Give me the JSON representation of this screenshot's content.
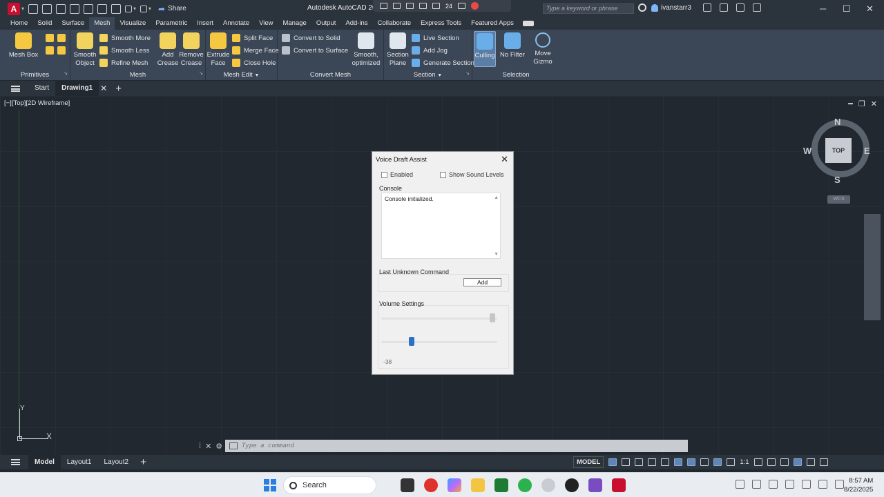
{
  "window": {
    "title": "Autodesk AutoCAD 20",
    "share_label": "Share",
    "search_placeholder": "Type a keyword or phrase",
    "user": "ivanstarr3",
    "recorder_time": "24"
  },
  "ribbon_tabs": [
    "Home",
    "Solid",
    "Surface",
    "Mesh",
    "Visualize",
    "Parametric",
    "Insert",
    "Annotate",
    "View",
    "Manage",
    "Output",
    "Add-ins",
    "Collaborate",
    "Express Tools",
    "Featured Apps"
  ],
  "ribbon_active_tab": "Mesh",
  "ribbon": {
    "mesh_box": "Mesh Box",
    "smooth_object": "Smooth Object",
    "smooth_more": "Smooth More",
    "smooth_less": "Smooth Less",
    "refine_mesh": "Refine Mesh",
    "add_crease": "Add Crease",
    "remove_crease": "Remove Crease",
    "extrude_face": "Extrude Face",
    "split_face": "Split Face",
    "merge_face": "Merge Face",
    "close_hole": "Close Hole",
    "convert_to_solid": "Convert to Solid",
    "convert_to_surface": "Convert to Surface",
    "smooth_optimized": "Smooth, optimized",
    "section_plane": "Section Plane",
    "live_section": "Live Section",
    "add_jog": "Add Jog",
    "generate_section": "Generate Section",
    "culling": "Culling",
    "no_filter": "No Filter",
    "move_gizmo": "Move Gizmo",
    "panels": {
      "primitives": "Primitives",
      "mesh": "Mesh",
      "mesh_edit": "Mesh Edit",
      "convert_mesh": "Convert Mesh",
      "section": "Section",
      "selection": "Selection"
    }
  },
  "file_tabs": {
    "start": "Start",
    "drawing": "Drawing1"
  },
  "viewport": {
    "label": "[−][Top][2D Wireframe]",
    "viewcube": {
      "top": "TOP",
      "n": "N",
      "s": "S",
      "e": "E",
      "w": "W",
      "wcs": "WCS"
    },
    "ucs": {
      "x": "X",
      "y": "Y"
    }
  },
  "dialog": {
    "title": "Voice Draft Assist",
    "enabled_label": "Enabled",
    "enabled_checked": false,
    "show_sound_levels_label": "Show Sound Levels",
    "show_sound_levels_checked": false,
    "console_label": "Console",
    "console_text": "Console initialized.",
    "last_unknown_label": "Last Unknown Command",
    "add_label": "Add",
    "volume_label": "Volume Settings",
    "slider1_value": 0.98,
    "slider2_value": 0.25,
    "volume_value": "-38",
    "accent": "#2a72c8"
  },
  "command_line": {
    "placeholder": "Type a command"
  },
  "layout_tabs": [
    "Model",
    "Layout1",
    "Layout2"
  ],
  "status": {
    "model": "MODEL",
    "scale": "1:1"
  },
  "taskbar": {
    "search_label": "Search",
    "time": "8:57 AM",
    "date": "8/22/2025"
  }
}
